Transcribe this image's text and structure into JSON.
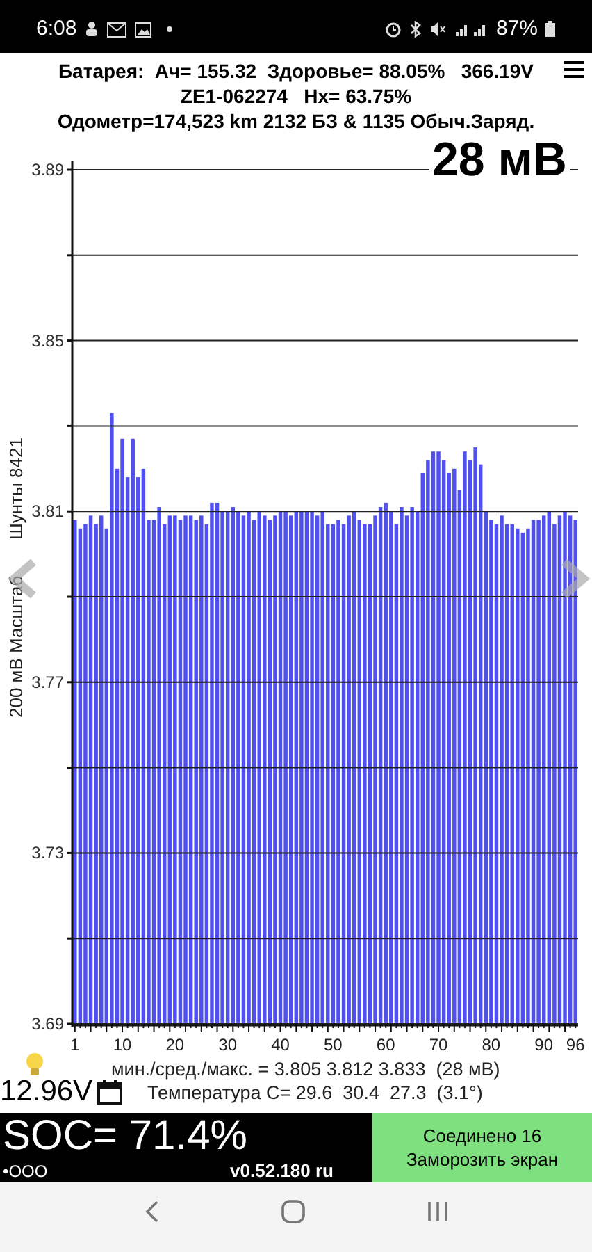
{
  "status_bar": {
    "time": "6:08",
    "battery": "87%"
  },
  "header": {
    "line_1": "Батарея:  Ач= 155.32  Здоровье= 88.05%   366.19V",
    "line_2": "ZE1-062274   Hx= 63.75%",
    "line_3": "Одометр=174,523 km 2132 БЗ & 1135 Обыч.Заряд."
  },
  "delta": "28 мВ",
  "shunts": "Шунты 8421",
  "chart_data": {
    "type": "bar",
    "ylabel": "200 мВ Масштаб",
    "ylim": [
      3.69,
      3.89
    ],
    "yticks": [
      {
        "value": 3.69,
        "label": "3.69"
      },
      {
        "value": 3.73,
        "label": "3.73"
      },
      {
        "value": 3.77,
        "label": "3.77"
      },
      {
        "value": 3.81,
        "label": "3.81"
      },
      {
        "value": 3.85,
        "label": "3.85"
      },
      {
        "value": 3.89,
        "label": "3.89"
      }
    ],
    "grid": true,
    "xlim": [
      0.5,
      96.5
    ],
    "x": [
      1,
      2,
      3,
      4,
      5,
      6,
      7,
      8,
      9,
      10,
      11,
      12,
      13,
      14,
      15,
      16,
      17,
      18,
      19,
      20,
      21,
      22,
      23,
      24,
      25,
      26,
      27,
      28,
      29,
      30,
      31,
      32,
      33,
      34,
      35,
      36,
      37,
      38,
      39,
      40,
      41,
      42,
      43,
      44,
      45,
      46,
      47,
      48,
      49,
      50,
      51,
      52,
      53,
      54,
      55,
      56,
      57,
      58,
      59,
      60,
      61,
      62,
      63,
      64,
      65,
      66,
      67,
      68,
      69,
      70,
      71,
      72,
      73,
      74,
      75,
      76,
      77,
      78,
      79,
      80,
      81,
      82,
      83,
      84,
      85,
      86,
      87,
      88,
      89,
      90,
      91,
      92,
      93,
      94,
      95,
      96
    ],
    "xticks": [
      {
        "value": 1,
        "label": "1"
      },
      {
        "value": 10,
        "label": "10"
      },
      {
        "value": 20,
        "label": "20"
      },
      {
        "value": 30,
        "label": "30"
      },
      {
        "value": 40,
        "label": "40"
      },
      {
        "value": 50,
        "label": "50"
      },
      {
        "value": 60,
        "label": "60"
      },
      {
        "value": 70,
        "label": "70"
      },
      {
        "value": 80,
        "label": "80"
      },
      {
        "value": 90,
        "label": "90"
      },
      {
        "value": 96,
        "label": "96"
      }
    ],
    "series": [
      {
        "color": "#5050f0",
        "values": [
          3.808,
          3.806,
          3.807,
          3.809,
          3.807,
          3.809,
          3.806,
          3.833,
          3.82,
          3.827,
          3.818,
          3.827,
          3.818,
          3.82,
          3.808,
          3.808,
          3.811,
          3.807,
          3.809,
          3.809,
          3.808,
          3.809,
          3.809,
          3.808,
          3.809,
          3.807,
          3.812,
          3.812,
          3.81,
          3.81,
          3.811,
          3.81,
          3.809,
          3.81,
          3.808,
          3.81,
          3.809,
          3.808,
          3.809,
          3.81,
          3.81,
          3.809,
          3.81,
          3.81,
          3.81,
          3.81,
          3.809,
          3.81,
          3.807,
          3.807,
          3.808,
          3.807,
          3.809,
          3.81,
          3.808,
          3.807,
          3.807,
          3.809,
          3.811,
          3.812,
          3.81,
          3.807,
          3.811,
          3.809,
          3.811,
          3.81,
          3.819,
          3.822,
          3.824,
          3.824,
          3.822,
          3.819,
          3.82,
          3.815,
          3.824,
          3.822,
          3.825,
          3.821,
          3.81,
          3.808,
          3.807,
          3.809,
          3.807,
          3.807,
          3.806,
          3.805,
          3.806,
          3.808,
          3.808,
          3.809,
          3.81,
          3.807,
          3.809,
          3.81,
          3.809,
          3.808
        ]
      }
    ]
  },
  "stats": "мин./сред./макс. = 3.805 3.812 3.833  (28 мВ)",
  "temperature": "Температура С= 29.6  30.4  27.3  (3.1°)",
  "aux_voltage": "12.96V",
  "soc": "SOC= 71.4%",
  "dots": "•OOO",
  "version": "v0.52.180 ru",
  "freeze_button": {
    "line_1": "Соединено 16",
    "line_2": "Заморозить экран"
  }
}
